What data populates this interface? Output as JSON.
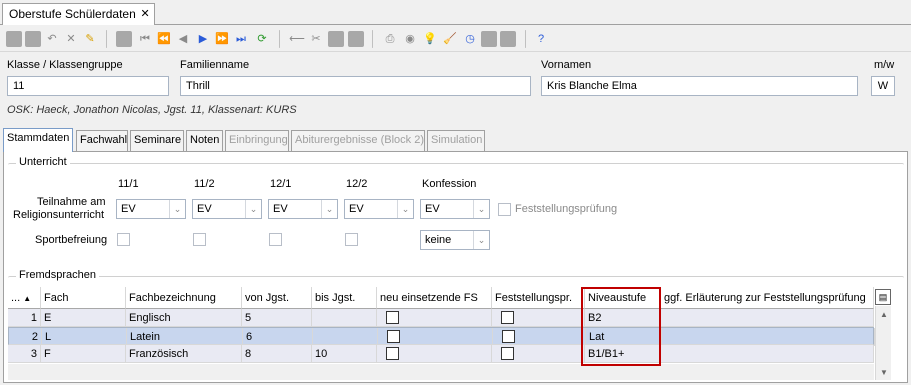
{
  "window": {
    "tab_title": "Oberstufe Schülerdaten",
    "close": "✕"
  },
  "toolbar": {
    "icons": [
      "save-icon",
      "save-disabled-icon",
      "undo-icon",
      "delete-icon",
      "edit-icon",
      "copy-icon",
      "first-icon",
      "prev-page-icon",
      "prev-icon",
      "next-icon",
      "next-page-icon",
      "last-icon",
      "refresh-icon",
      "back-icon",
      "cut-icon",
      "paste-icon",
      "print-icon",
      "view-icon",
      "hint-icon",
      "clean-icon",
      "clock-icon",
      "export-icon",
      "import-icon",
      "help-icon"
    ]
  },
  "header": {
    "klasse_label": "Klasse / Klassengruppe",
    "klasse_value": "11",
    "familienname_label": "Familienname",
    "familienname_value": "Thrill",
    "vornamen_label": "Vornamen",
    "vornamen_value": "Kris Blanche Elma",
    "mw_label": "m/w",
    "mw_value": "W",
    "osk_line": "OSK: Haeck, Jonathon Nicolas, Jgst. 11, Klassenart: KURS"
  },
  "tabs": [
    {
      "label": "Stammdaten",
      "active": true,
      "disabled": false
    },
    {
      "label": "Fachwahl",
      "active": false,
      "disabled": false
    },
    {
      "label": "Seminare",
      "active": false,
      "disabled": false
    },
    {
      "label": "Noten",
      "active": false,
      "disabled": false
    },
    {
      "label": "Einbringung",
      "active": false,
      "disabled": true
    },
    {
      "label": "Abiturergebnisse (Block 2)",
      "active": false,
      "disabled": true
    },
    {
      "label": "Simulation",
      "active": false,
      "disabled": true
    }
  ],
  "unterricht": {
    "title": "Unterricht",
    "col_headers": [
      "11/1",
      "11/2",
      "12/1",
      "12/2",
      "Konfession"
    ],
    "religion_label_1": "Teilnahme am",
    "religion_label_2": "Religionsunterricht",
    "religion_values": [
      "EV",
      "EV",
      "EV",
      "EV",
      "EV"
    ],
    "feststellung_label": "Feststellungsprüfung",
    "sport_label": "Sportbefreiung",
    "sport_select": "keine"
  },
  "fremdsprachen": {
    "title": "Fremdsprachen",
    "columns": [
      "...",
      "Fach",
      "Fachbezeichnung",
      "von Jgst.",
      "bis Jgst.",
      "neu einsetzende FS",
      "Feststellungspr.",
      "Niveaustufe",
      "ggf. Erläuterung zur Feststellungsprüfung"
    ],
    "rows": [
      {
        "nr": "1",
        "fach": "E",
        "bezeichnung": "Englisch",
        "von": "5",
        "bis": "",
        "niveau": "B2",
        "erlaeuterung": ""
      },
      {
        "nr": "2",
        "fach": "L",
        "bezeichnung": "Latein",
        "von": "6",
        "bis": "",
        "niveau": "Lat",
        "erlaeuterung": ""
      },
      {
        "nr": "3",
        "fach": "F",
        "bezeichnung": "Französisch",
        "von": "8",
        "bis": "10",
        "niveau": "B1/B1+",
        "erlaeuterung": ""
      }
    ],
    "highlight_color": "#c00000"
  }
}
